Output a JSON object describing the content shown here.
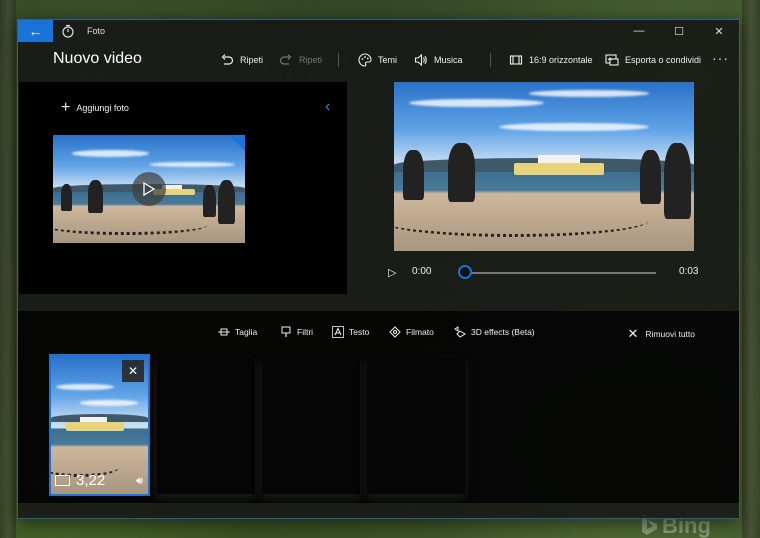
{
  "window": {
    "app_title": "Foto",
    "controls": {
      "minimize": "—",
      "maximize": "☐",
      "close": "✕"
    }
  },
  "toolbar": {
    "doc_title": "Nuovo video",
    "undo_label": "Ripeti",
    "redo_label": "Ripeti",
    "themes_label": "Temi",
    "music_label": "Musica",
    "aspect_label": "16:9 orizzontale",
    "export_label": "Esporta o condividi",
    "more_label": "···"
  },
  "library": {
    "add_photo_label": "Aggiungi foto",
    "collapse_glyph": "‹"
  },
  "player": {
    "current_time": "0:00",
    "end_time": "0:03",
    "progress": 0
  },
  "storyboard": {
    "tools": {
      "trim": "Taglia",
      "filters": "Filtri",
      "text": "Testo",
      "motion": "Filmato",
      "effects3d": "3D effects (Beta)",
      "remove_all": "Rimuovi tutto"
    },
    "cards": [
      {
        "duration": "3,22",
        "selected": true
      }
    ]
  },
  "desktop": {
    "watermark": "Bing"
  },
  "colors": {
    "accent": "#1a73d6"
  }
}
